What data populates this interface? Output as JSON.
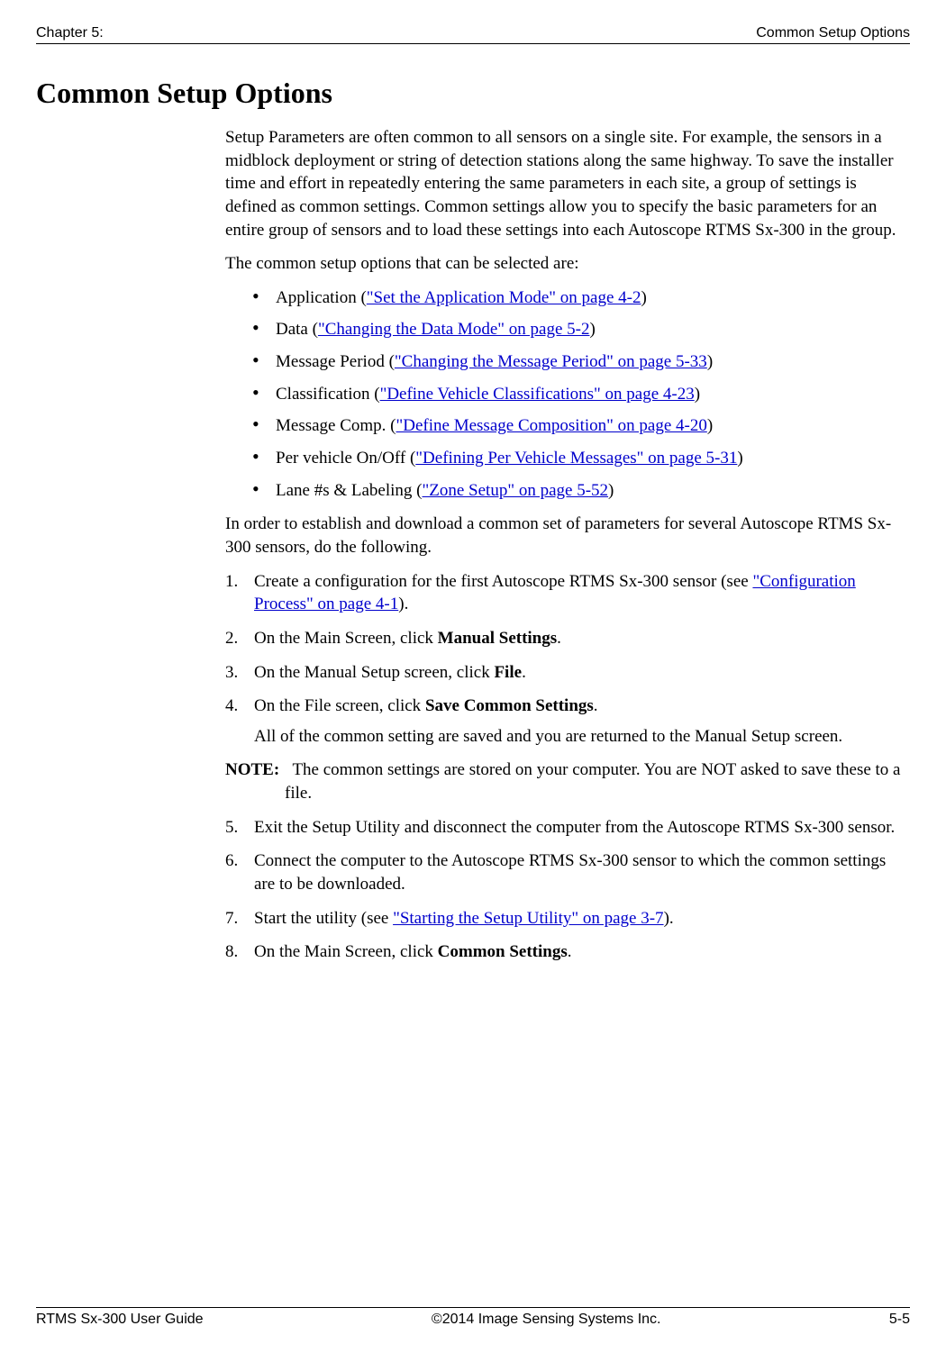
{
  "header": {
    "left": "Chapter 5:",
    "right": "Common Setup Options"
  },
  "title": "Common Setup Options",
  "intro1": "Setup Parameters are often common to all sensors on a single site. For example, the sensors in a midblock deployment or string of detection stations along the same highway. To save the installer time and effort in repeatedly entering the same parameters in each site, a group of settings is defined as common settings. Common settings allow you to specify the basic parameters for an entire group of sensors and to load these settings into each Autoscope RTMS Sx-300 in the group.",
  "intro2": "The common setup options that can be selected are:",
  "bullets": [
    {
      "prefix": "Application (",
      "link": "\"Set the Application Mode\" on page 4-2",
      "suffix": ")"
    },
    {
      "prefix": "Data (",
      "link": "\"Changing the Data Mode\" on page 5-2",
      "suffix": ")"
    },
    {
      "prefix": "Message Period (",
      "link": "\"Changing the Message Period\" on page 5-33",
      "suffix": ")"
    },
    {
      "prefix": "Classification (",
      "link": "\"Define Vehicle Classifications\" on page 4-23",
      "suffix": ")"
    },
    {
      "prefix": "Message Comp. (",
      "link": "\"Define Message Composition\" on page 4-20",
      "suffix": ")"
    },
    {
      "prefix": "Per vehicle On/Off (",
      "link": "\"Defining Per Vehicle Messages\" on page 5-31",
      "suffix": ")"
    },
    {
      "prefix": "Lane #s & Labeling (",
      "link": "\"Zone Setup\" on page 5-52",
      "suffix": ")"
    }
  ],
  "after_bullets": "In order to establish and download a common set of parameters for several Autoscope RTMS Sx-300 sensors, do the following.",
  "steps": {
    "s1": {
      "num": "1.",
      "text_a": "Create a configuration for the first Autoscope RTMS Sx-300 sensor (see ",
      "link": "\"Configuration Process\" on page 4-1",
      "text_b": ")."
    },
    "s2": {
      "num": "2.",
      "text_a": "On the Main Screen, click ",
      "bold": "Manual Settings",
      "text_b": "."
    },
    "s3": {
      "num": "3.",
      "text_a": "On the Manual Setup screen, click ",
      "bold": "File",
      "text_b": "."
    },
    "s4": {
      "num": "4.",
      "text_a": "On the File screen, click ",
      "bold": "Save Common Settings",
      "text_b": ".",
      "sub": "All of the common setting are saved and you are returned to the Manual Setup screen."
    },
    "note": {
      "label": "NOTE:",
      "text": "The common settings are stored on your computer. You are NOT asked to save these to a file."
    },
    "s5": {
      "num": "5.",
      "text": "Exit the Setup Utility and disconnect the computer from the Autoscope RTMS Sx-300 sensor."
    },
    "s6": {
      "num": "6.",
      "text": "Connect the computer to the Autoscope RTMS Sx-300 sensor to which the common settings are to be downloaded."
    },
    "s7": {
      "num": "7.",
      "text_a": "Start the utility (see ",
      "link": "\"Starting the Setup Utility\" on page 3-7",
      "text_b": ")."
    },
    "s8": {
      "num": "8.",
      "text_a": "On the Main Screen, click ",
      "bold": "Common Settings",
      "text_b": "."
    }
  },
  "footer": {
    "left": "RTMS Sx-300 User Guide",
    "center": "©2014 Image Sensing Systems Inc.",
    "right": "5-5"
  }
}
